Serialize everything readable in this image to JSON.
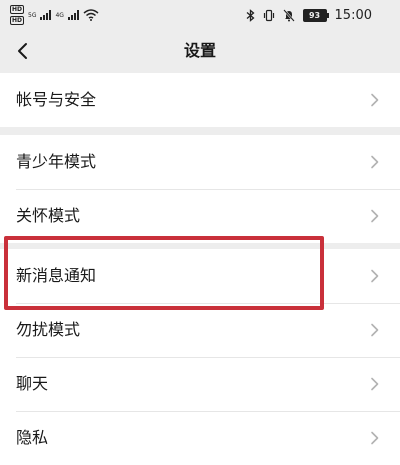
{
  "status_bar": {
    "sim1_badge": "HD",
    "sim2_badge": "HD",
    "sim1_network": "5G",
    "sim2_network": "4G",
    "battery_level": "93",
    "time": "15:00",
    "icons": [
      "signal-icon",
      "wifi-icon",
      "bluetooth-icon",
      "vibrate-icon",
      "mute-icon",
      "battery-icon"
    ]
  },
  "nav": {
    "title": "设置",
    "back_icon": "chevron-left-icon"
  },
  "groups": [
    {
      "items": [
        {
          "label": "帐号与安全"
        }
      ]
    },
    {
      "items": [
        {
          "label": "青少年模式"
        },
        {
          "label": "关怀模式"
        }
      ]
    },
    {
      "items": [
        {
          "label": "新消息通知"
        },
        {
          "label": "勿扰模式"
        },
        {
          "label": "聊天"
        },
        {
          "label": "隐私"
        }
      ]
    }
  ],
  "highlight": {
    "target": "新消息通知",
    "color": "#c9303a"
  },
  "colors": {
    "background": "#ededed",
    "item_background": "#ffffff",
    "text": "#191919",
    "chevron": "#b2b2b2"
  }
}
